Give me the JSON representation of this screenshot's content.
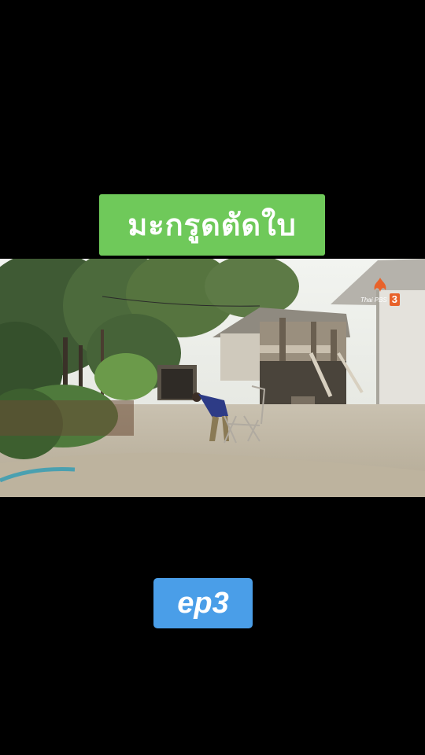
{
  "title": {
    "text": "มะกรูดตัดใบ",
    "color": "#6fc95a"
  },
  "video": {
    "channel_logo": {
      "icon": "thai-pbs-flame-icon",
      "text": "Thai PBS",
      "number": "3",
      "accent": "#e8622a"
    }
  },
  "episode": {
    "label": "ep3",
    "color": "#4a9ee8"
  }
}
